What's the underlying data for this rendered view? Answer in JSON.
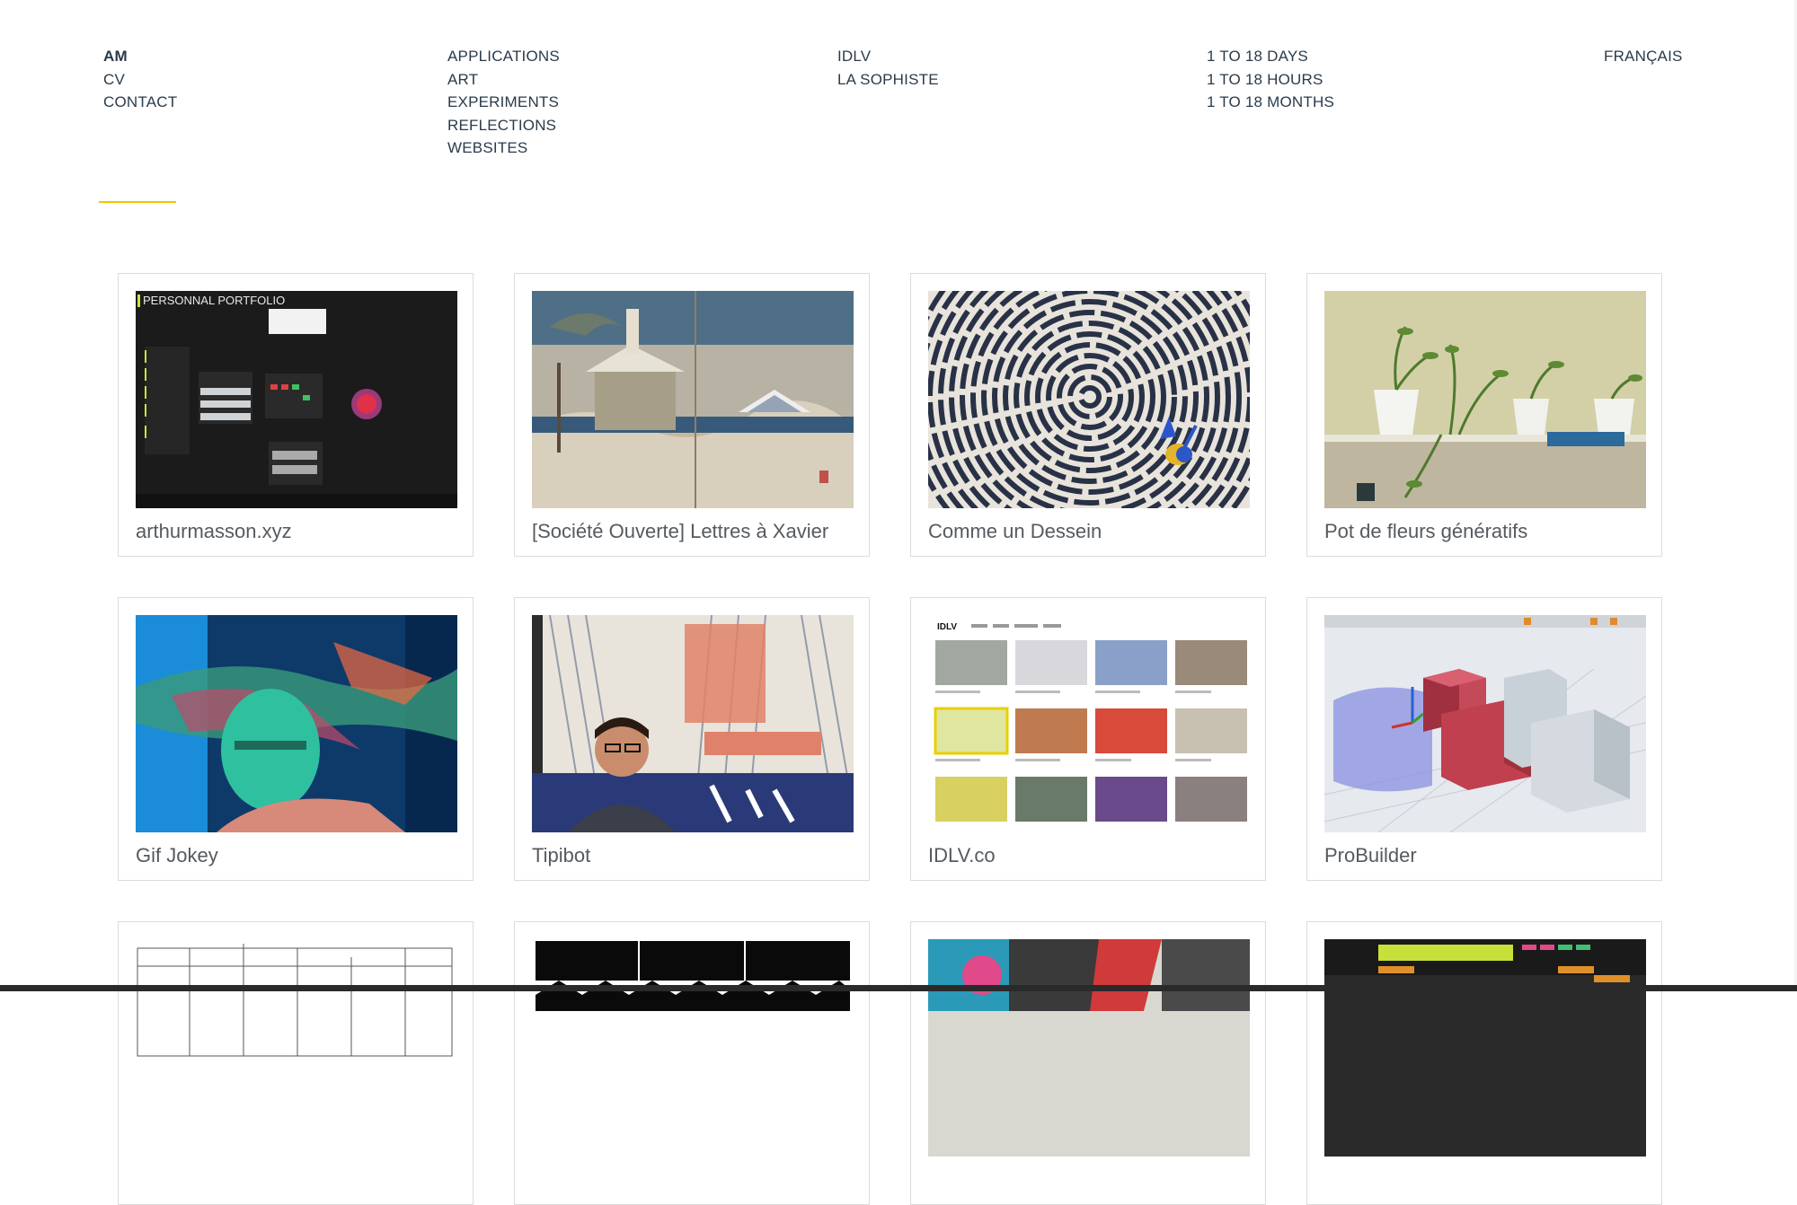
{
  "nav": {
    "col1": [
      "AM",
      "CV",
      "CONTACT"
    ],
    "col2": [
      "APPLICATIONS",
      "ART",
      "EXPERIMENTS",
      "REFLECTIONS",
      "WEBSITES"
    ],
    "col3": [
      "IDLV",
      "LA SOPHISTE"
    ],
    "col4": [
      "1 TO 18 DAYS",
      "1 TO 18 HOURS",
      "1 TO 18 MONTHS"
    ],
    "col5": [
      "FRANÇAIS"
    ]
  },
  "colors": {
    "nav_text": "#2b3b4a",
    "accent_rule": "#f2c300",
    "card_border": "#dcdcdc",
    "caption_text": "#555a5f"
  },
  "projects": [
    {
      "title": "arthurmasson.xyz",
      "thumb_icon": "portfolio-screenshot",
      "thumb_text": "PERSONNAL PORTFOLIO"
    },
    {
      "title": "[Société Ouverte] Lettres à Xavier",
      "thumb_icon": "japanese-print"
    },
    {
      "title": "Comme un Dessein",
      "thumb_icon": "spiral-drawing"
    },
    {
      "title": "Pot de fleurs génératifs",
      "thumb_icon": "plant-pots"
    },
    {
      "title": "Gif Jokey",
      "thumb_icon": "glitch-portrait"
    },
    {
      "title": "Tipibot",
      "thumb_icon": "maker-faire-portrait"
    },
    {
      "title": "IDLV.co",
      "thumb_icon": "website-grid",
      "thumb_text": "IDLV"
    },
    {
      "title": "ProBuilder",
      "thumb_icon": "3d-blocks"
    },
    {
      "title": "",
      "thumb_icon": "floor-plan"
    },
    {
      "title": "",
      "thumb_icon": "black-pattern"
    },
    {
      "title": "",
      "thumb_icon": "color-photo"
    },
    {
      "title": "",
      "thumb_icon": "synth-interface"
    }
  ]
}
